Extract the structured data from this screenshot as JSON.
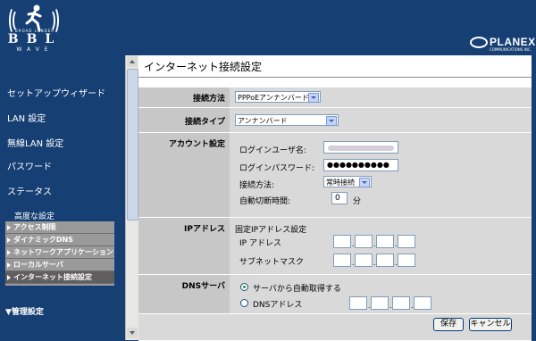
{
  "header": {
    "logo_left": {
      "word": "BBL",
      "tagline": "BROAD LANDER",
      "wave": "WAVE"
    },
    "logo_right": {
      "name": "PLANEX",
      "sub": "COMMUNICATIONS INC."
    }
  },
  "sidebar": {
    "items": [
      {
        "label": "セットアップウィザード"
      },
      {
        "label": "LAN 設定"
      },
      {
        "label": "無線LAN 設定"
      },
      {
        "label": "パスワード"
      },
      {
        "label": "ステータス"
      }
    ],
    "advanced": {
      "label": "高度な設定",
      "sub_items": [
        {
          "label": "アクセス制限"
        },
        {
          "label": "ダイナミックDNS"
        },
        {
          "label": "ネットワークアプリケーション"
        },
        {
          "label": "ローカルサーバ"
        },
        {
          "label": "インターネット接続設定",
          "active": true
        }
      ]
    },
    "admin": {
      "label": "▼管理設定"
    }
  },
  "page": {
    "title": "インターネット接続設定",
    "connection_method": {
      "label": "接続方法",
      "value": "PPPoEアンナンバード"
    },
    "connection_type": {
      "label": "接続タイプ",
      "value": "アンナンバード"
    },
    "account": {
      "label": "アカウント設定",
      "username_label": "ログインユーザ名:",
      "username_value": "",
      "password_label": "ログインパスワード:",
      "password_value": "●●●●●●●●●●",
      "method_label": "接続方法:",
      "method_value": "常時接続",
      "auto_disconnect_label": "自動切断時間:",
      "auto_disconnect_value": "0",
      "auto_disconnect_unit": "分"
    },
    "ip": {
      "label": "IPアドレス",
      "heading": "固定IPアドレス設定",
      "ip_label": "IP アドレス",
      "mask_label": "サブネットマスク"
    },
    "dns": {
      "label": "DNSサーバ",
      "auto_label": "サーバから自動取得する",
      "auto_selected": true,
      "manual_label": "DNSアドレス"
    },
    "buttons": {
      "save": "保存",
      "cancel": "キャンセル"
    }
  }
}
